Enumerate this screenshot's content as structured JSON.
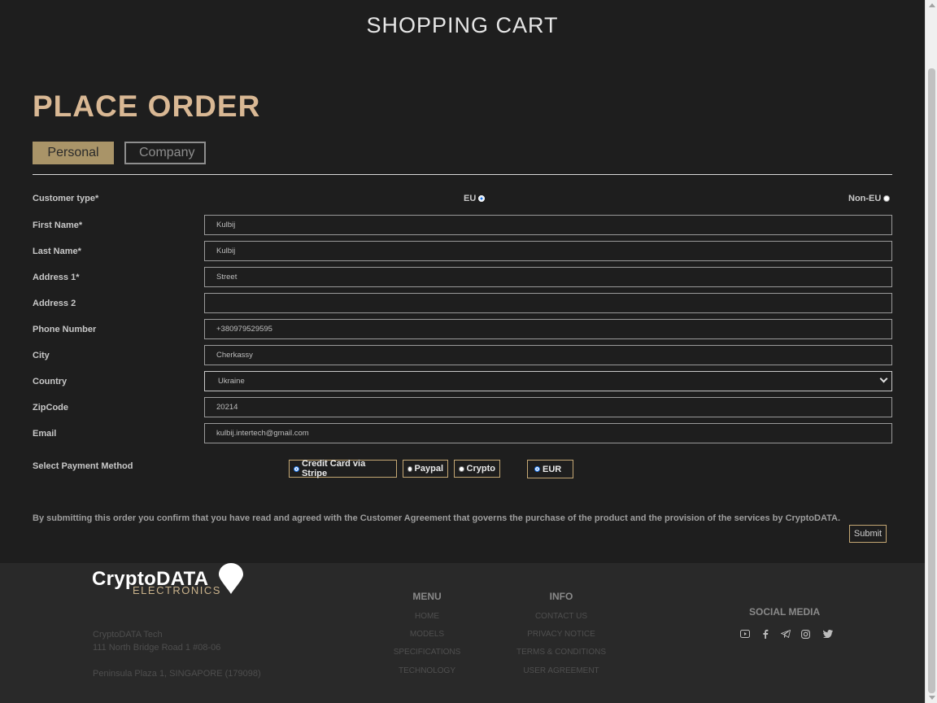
{
  "header": {
    "title": "SHOPPING CART"
  },
  "page_title": "PLACE ORDER",
  "tabs": [
    {
      "label": "Personal",
      "active": true
    },
    {
      "label": "Company",
      "active": false
    }
  ],
  "customer_type": {
    "label": "Customer type*",
    "options": [
      "EU",
      "Non-EU"
    ],
    "selected": "EU"
  },
  "form": {
    "first_name": {
      "label": "First Name*",
      "value": "Kulbij"
    },
    "last_name": {
      "label": "Last Name*",
      "value": "Kulbij"
    },
    "address1": {
      "label": "Address 1*",
      "value": "Street"
    },
    "address2": {
      "label": "Address 2",
      "value": ""
    },
    "phone": {
      "label": "Phone Number",
      "value": "+380979529595"
    },
    "city": {
      "label": "City",
      "value": "Cherkassy"
    },
    "country": {
      "label": "Country",
      "value": "Ukraine"
    },
    "zip": {
      "label": "ZipCode",
      "value": "20214"
    },
    "email": {
      "label": "Email",
      "value": "kulbij.intertech@gmail.com"
    }
  },
  "payment": {
    "label": "Select Payment Method",
    "methods": [
      {
        "label": "Credit Card via Stripe",
        "selected": true
      },
      {
        "label": "Paypal",
        "selected": false
      },
      {
        "label": "Crypto",
        "selected": false
      }
    ],
    "currency": {
      "label": "EUR",
      "selected": true
    }
  },
  "agreement_text": "By submitting this order you confirm that you have read and agreed with the Customer Agreement that governs the purchase of the product and the provision of the services by CryptoDATA.",
  "submit_label": "Submit",
  "footer": {
    "logo_top": "CryptoDATA",
    "logo_bottom": "ELECTRONICS",
    "address": [
      "CryptoDATA Tech",
      "111 North Bridge Road 1 #08-06",
      "Peninsula Plaza 1, SINGAPORE (179098)"
    ],
    "menu": {
      "title": "MENU",
      "links": [
        "HOME",
        "MODELS",
        "SPECIFICATIONS",
        "TECHNOLOGY"
      ]
    },
    "info": {
      "title": "INFO",
      "links": [
        "CONTACT US",
        "PRIVACY NOTICE",
        "TERMS & CONDITIONS",
        "USER AGREEMENT"
      ]
    },
    "social_title": "SOCIAL MEDIA",
    "social_icons": [
      "youtube-icon",
      "facebook-icon",
      "telegram-icon",
      "instagram-icon",
      "twitter-icon"
    ]
  },
  "colors": {
    "accent": "#d9b894",
    "tab_active": "#a99468",
    "border_gold": "#c5a874",
    "radio_on": "#1a73e8"
  }
}
